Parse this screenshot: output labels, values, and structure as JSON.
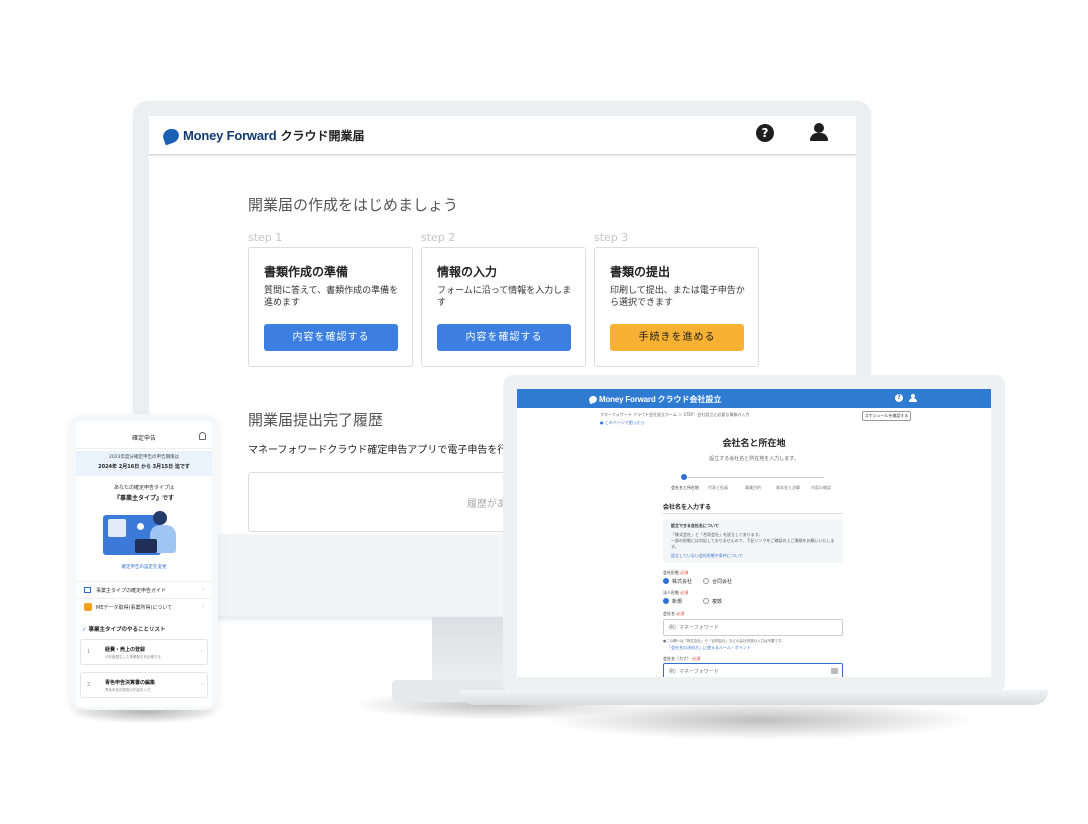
{
  "desktop": {
    "brand": "Money Forward",
    "product": "クラウド開業届",
    "heading": "開業届の作成をはじめましょう",
    "steps": [
      {
        "step": "step 1",
        "title": "書類作成の準備",
        "desc": "質問に答えて、書類作成の準備を進めます",
        "button": "内容を確認する",
        "color": "#3c7fe0"
      },
      {
        "step": "step 2",
        "title": "情報の入力",
        "desc": "フォームに沿って情報を入力します",
        "button": "内容を確認する",
        "color": "#3c7fe0"
      },
      {
        "step": "step 3",
        "title": "書類の提出",
        "desc": "印刷して提出、または電子申告から選択できます",
        "button": "手続きを進める",
        "color": "#f8b133"
      }
    ],
    "history_heading": "開業届提出完了履歴",
    "history_desc": "マネーフォワードクラウド確定申告アプリで電子申告を行っ",
    "history_empty": "履歴があ"
  },
  "laptop": {
    "brand": "Money Forward",
    "product": "クラウド会社設立",
    "breadcrumb": "マネーフォワード クラウド会社設立ホーム ＞ STEP：会社設立に必要な情報の入力",
    "page_help": "このページで困ったら",
    "schedule_button": "スケジュールを確認する",
    "title": "会社名と所在地",
    "subtitle": "設立する会社名と所在地を入力します。",
    "progress": [
      "会社名と所在地",
      "代表と役員",
      "事業目的",
      "資本金と決算",
      "内容の確認"
    ],
    "section": "会社名を入力する",
    "notice_title": "設立できる会社名について",
    "notice_lines": [
      "「株式会社」と「合同会社」を設立してあります。",
      "一部の形態には対応しておりませんので、下記リンクをご確認の上ご連絡をお願いいたします。"
    ],
    "notice_link": "設立していない会社形態や条件について",
    "company_type_label": "会社形態",
    "company_types": [
      "株式会社",
      "合同会社"
    ],
    "corp_count_label": "法人形態",
    "corp_counts": [
      "新規",
      "複数"
    ],
    "required": "必須",
    "name_label": "会社名",
    "name_placeholder": "例）マネーフォワード",
    "name_note": "●この欄へは「株式会社」や「合同会社」などの会社形態の入力は不要です。",
    "name_link": "「会社名の決め方」に使えるルール・ポイント",
    "kana_label": "会社名（カナ）",
    "kana_placeholder": "例）マネーフォワード"
  },
  "phone": {
    "title": "確定申告",
    "banner_line1": "2023年度分確定申告の申告期限は",
    "banner_line2": "2024年 2月16日 から 3月15日 迄です",
    "type_intro": "あなたの確定申告タイプは",
    "type_name": "『事業主タイプ』です",
    "change_link": "確定申告の設定を変更",
    "menu": [
      "事業主タイプの確定申告ガイド",
      "MEデータ取得(事業所得)について"
    ],
    "todo_heading": "事業主タイプのやることリスト",
    "tasks": [
      {
        "num": "1",
        "title": "経費・売上の登録",
        "desc": "今年度発生した事業取引を記帳する"
      },
      {
        "num": "2",
        "title": "青色申告決算書の編集",
        "desc": "青色申告決算書の内容を入力"
      }
    ]
  }
}
